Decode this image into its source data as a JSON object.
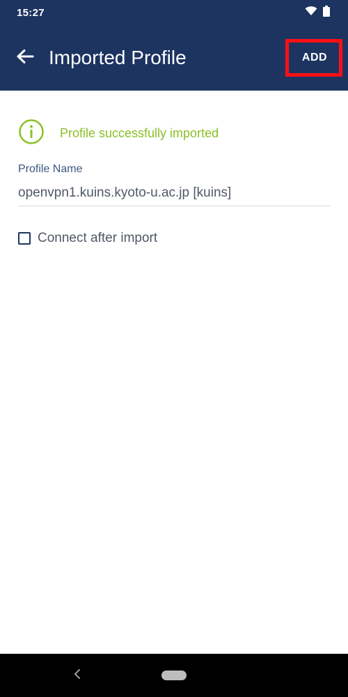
{
  "status_bar": {
    "time": "15:27",
    "icons": [
      "wifi-icon",
      "battery-icon"
    ]
  },
  "app_bar": {
    "title": "Imported Profile",
    "add_label": "ADD",
    "back_icon": "arrow-left-icon"
  },
  "notice": {
    "icon": "info-circle-icon",
    "text": "Profile successfully imported"
  },
  "profile_name": {
    "label": "Profile Name",
    "value": "openvpn1.kuins.kyoto-u.ac.jp [kuins]"
  },
  "connect_after_import": {
    "label": "Connect after import",
    "checked": false
  },
  "colors": {
    "primary": "#1d3461",
    "success": "#8cbf26",
    "highlight": "#ff0f14",
    "label": "#3c5783",
    "text": "#505866"
  }
}
